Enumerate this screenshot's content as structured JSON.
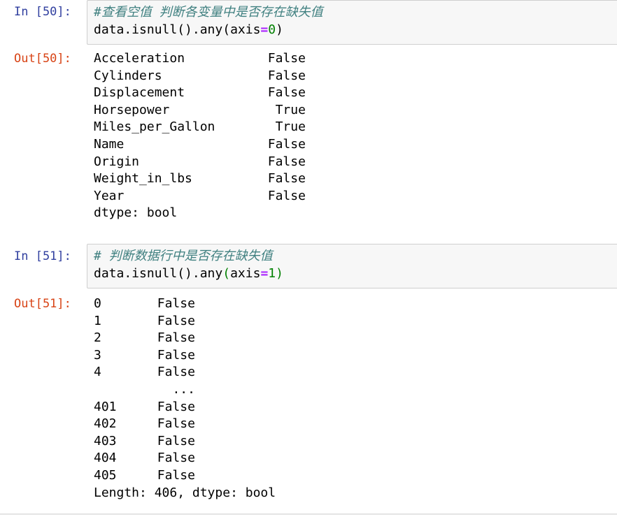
{
  "cells": [
    {
      "in_prompt": "In [50]:",
      "comment": "#查看空值 判断各变量中是否存在缺失值",
      "code_prefix": "data.isnull().any(axis",
      "code_op": "=",
      "code_num": "0",
      "code_suffix": ")",
      "out_prompt": "Out[50]:",
      "output_rows": [
        {
          "key": "Acceleration",
          "value": "False"
        },
        {
          "key": "Cylinders",
          "value": "False"
        },
        {
          "key": "Displacement",
          "value": "False"
        },
        {
          "key": "Horsepower",
          "value": "True"
        },
        {
          "key": "Miles_per_Gallon",
          "value": "True"
        },
        {
          "key": "Name",
          "value": "False"
        },
        {
          "key": "Origin",
          "value": "False"
        },
        {
          "key": "Weight_in_lbs",
          "value": "False"
        },
        {
          "key": "Year",
          "value": "False"
        }
      ],
      "output_footer": "dtype: bool"
    },
    {
      "in_prompt": "In [51]:",
      "comment": "# 判断数据行中是否存在缺失值",
      "code_prefix": "data.isnull().any",
      "code_paren_open": "(",
      "code_kw": "axis",
      "code_op": "=",
      "code_num": "1",
      "code_paren_close": ")",
      "out_prompt": "Out[51]:",
      "output_rows": [
        {
          "key": "0",
          "value": "False"
        },
        {
          "key": "1",
          "value": "False"
        },
        {
          "key": "2",
          "value": "False"
        },
        {
          "key": "3",
          "value": "False"
        },
        {
          "key": "4",
          "value": "False"
        },
        {
          "key": "",
          "value": "..."
        },
        {
          "key": "401",
          "value": "False"
        },
        {
          "key": "402",
          "value": "False"
        },
        {
          "key": "403",
          "value": "False"
        },
        {
          "key": "404",
          "value": "False"
        },
        {
          "key": "405",
          "value": "False"
        }
      ],
      "output_footer": "Length: 406, dtype: bool"
    }
  ]
}
